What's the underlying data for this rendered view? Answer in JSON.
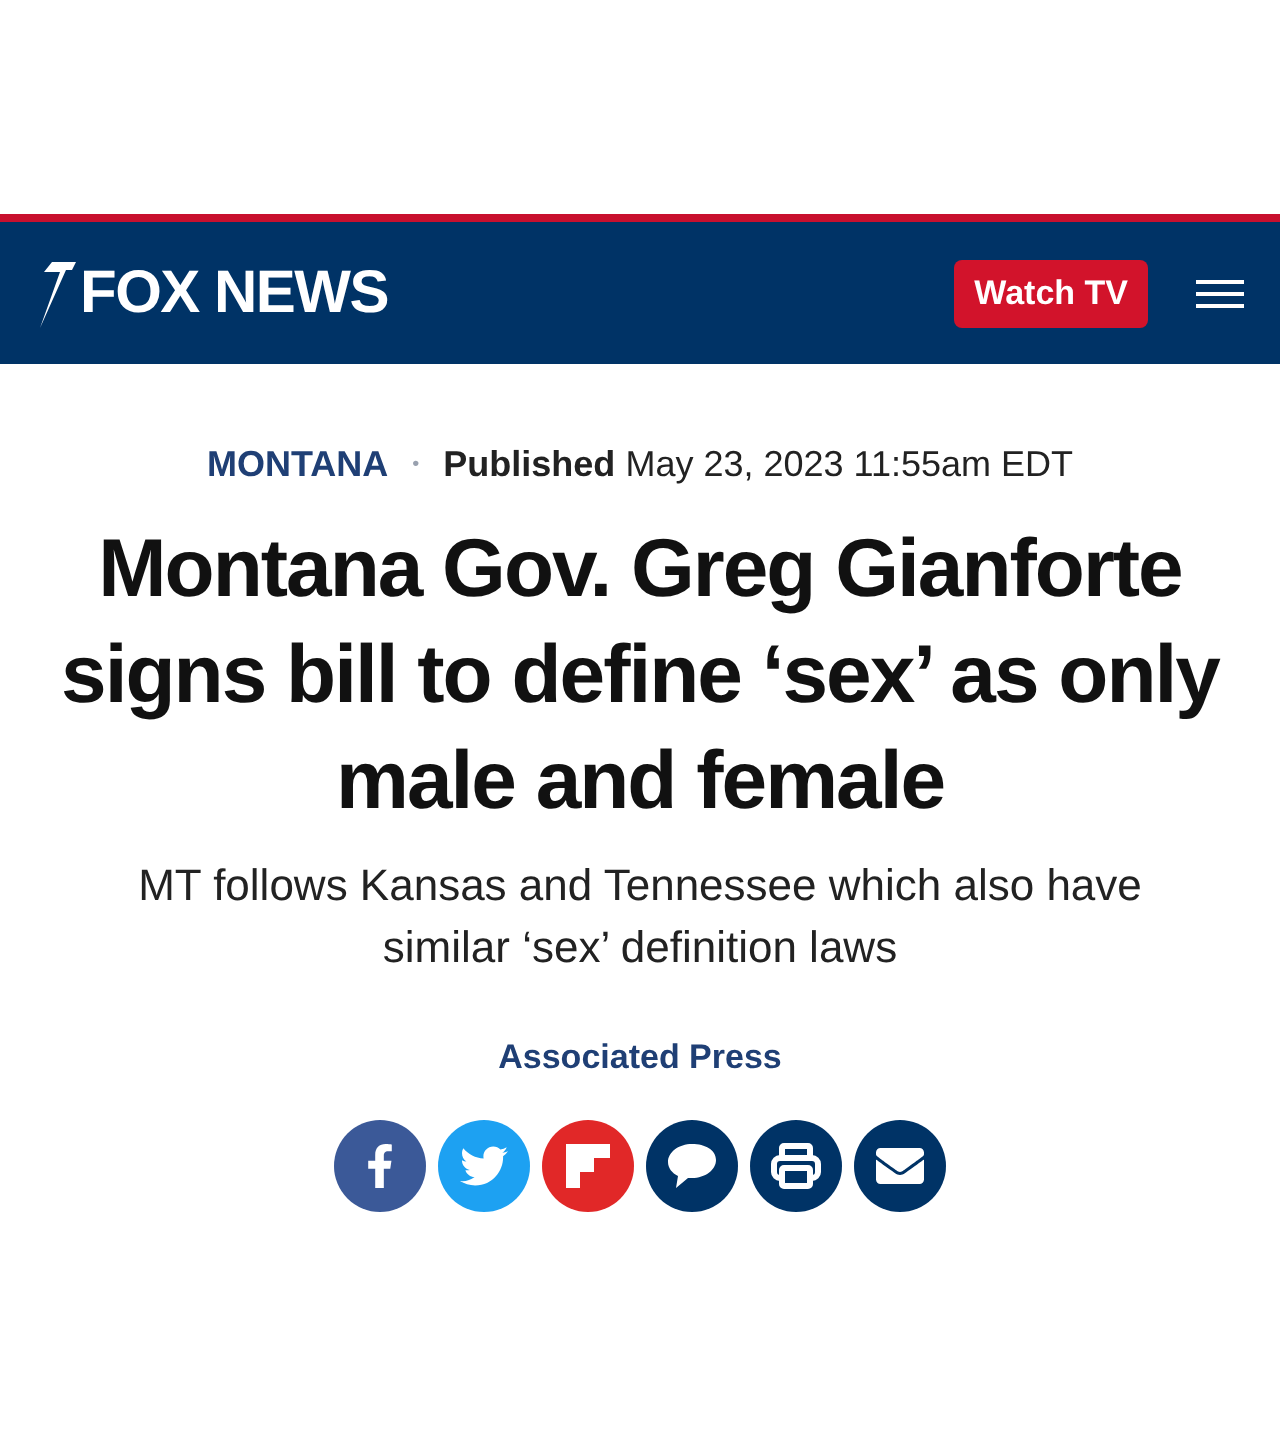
{
  "header": {
    "logo": "FOX NEWS",
    "watch_button": "Watch TV"
  },
  "article": {
    "category": "MONTANA",
    "separator": "•",
    "published_label": "Published",
    "published_date": "May 23, 2023 11:55am EDT",
    "headline": "Montana Gov. Greg Gianforte signs bill to define ‘sex’ as only male and female",
    "subheadline": "MT follows Kansas and Tennessee which also have similar ‘sex’ definition laws",
    "author": "Associated Press",
    "share_buttons": [
      {
        "kind": "facebook",
        "color": "#3b5998"
      },
      {
        "kind": "twitter",
        "color": "#1da1f2"
      },
      {
        "kind": "flipboard",
        "color": "#e12828"
      },
      {
        "kind": "comment",
        "color": "#003366"
      },
      {
        "kind": "print",
        "color": "#003366"
      },
      {
        "kind": "email",
        "color": "#003366"
      }
    ]
  }
}
